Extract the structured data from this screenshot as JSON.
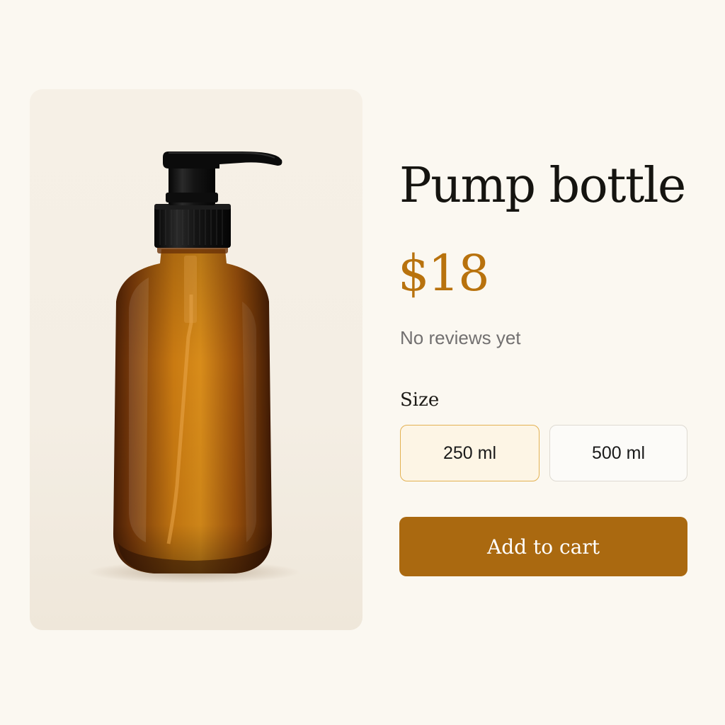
{
  "product": {
    "title": "Pump bottle",
    "price": "$18",
    "reviews_text": "No reviews yet",
    "image_alt": "amber-glass-pump-bottle"
  },
  "size": {
    "label": "Size",
    "options": [
      {
        "label": "250 ml",
        "selected": true
      },
      {
        "label": "500 ml",
        "selected": false
      }
    ]
  },
  "cart": {
    "button_label": "Add to cart"
  },
  "colors": {
    "accent": "#aa6910",
    "price": "#b8720d",
    "selected_border": "#e3b152",
    "selected_fill": "#fdf5e5",
    "page_background": "#fbf8f1"
  }
}
